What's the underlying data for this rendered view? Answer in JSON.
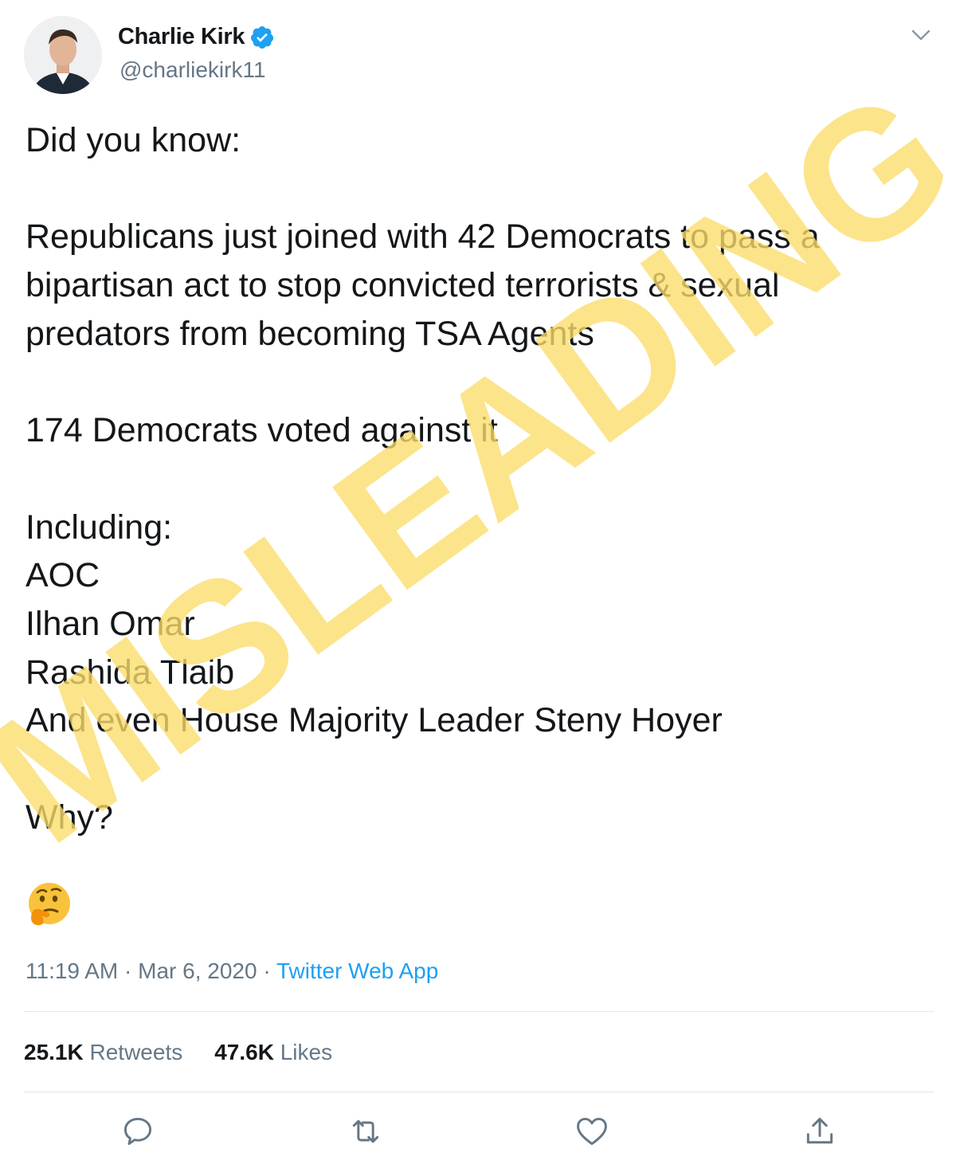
{
  "tweet": {
    "author": {
      "name": "Charlie Kirk",
      "handle": "@charliekirk11"
    },
    "text": "Did you know:\n\nRepublicans just joined with 42 Democrats to pass a\nbipartisan act to stop convicted terrorists & sexual\npredators from becoming TSA Agents\n\n174 Democrats voted against it\n\nIncluding:\nAOC\nIlhan Omar\nRashida Tlaib\nAnd even House Majority Leader Steny Hoyer\n\nWhy?",
    "time": "11:19 AM",
    "separator1": " · ",
    "date": "Mar 6, 2020",
    "separator2": " · ",
    "source": "Twitter Web App",
    "retweets_count": "25.1K",
    "retweets_label": "Retweets",
    "likes_count": "47.6K",
    "likes_label": "Likes",
    "emoji": "thinking-face"
  },
  "overlay": {
    "label": "MISLEADING",
    "color": "#fbdd6a"
  },
  "colors": {
    "link": "#1da1f2",
    "muted": "#657786",
    "text": "#14171a",
    "verified": "#1da1f2"
  },
  "icons": [
    "chevron-down-icon",
    "verified-badge-icon",
    "reply-icon",
    "retweet-icon",
    "like-icon",
    "share-icon"
  ]
}
